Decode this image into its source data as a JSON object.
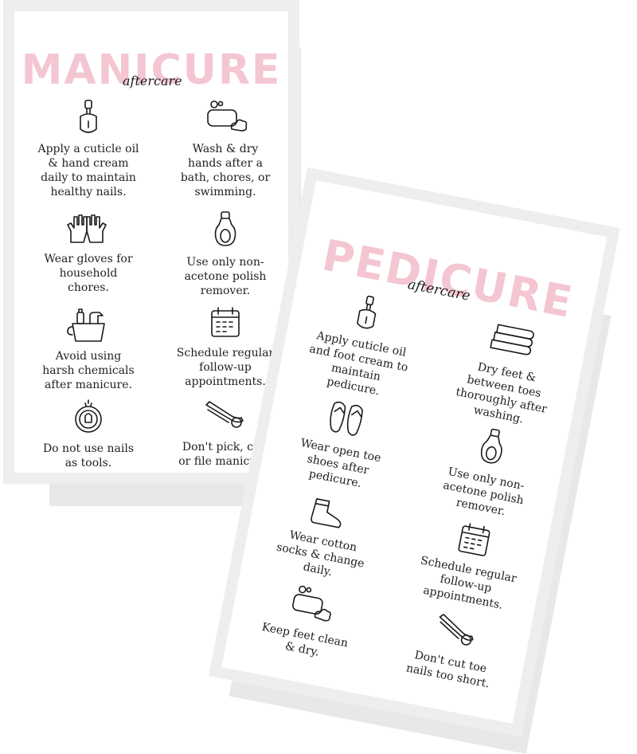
{
  "colors": {
    "title_pink": "#f4c6d1",
    "card_border": "#eeeeee",
    "shadow": "#e8e8e8",
    "ink": "#1a1a1a"
  },
  "manicure_card": {
    "title": "MANICURE",
    "subtitle": "aftercare",
    "items": [
      {
        "icon": "cuticle-oil-bottle-icon",
        "text": "Apply a cuticle oil\n& hand cream\ndaily to maintain\nhealthy nails."
      },
      {
        "icon": "soap-bar-icon",
        "text": "Wash & dry\nhands after a\nbath, chores, or\nswimming."
      },
      {
        "icon": "gloves-icon",
        "text": "Wear gloves for\nhousehold\nchores."
      },
      {
        "icon": "polish-remover-bottle-icon",
        "text": "Use only non-\nacetone polish\nremover."
      },
      {
        "icon": "cleaning-bucket-icon",
        "text": "Avoid using\nharsh chemicals\nafter manicure."
      },
      {
        "icon": "calendar-icon",
        "text": "Schedule regular\nfollow-up\nappointments."
      },
      {
        "icon": "nail-tool-icon",
        "text": "Do not use nails\nas tools."
      },
      {
        "icon": "nail-clipper-icon",
        "text": "Don't pick, cut,\nor file manicure."
      }
    ]
  },
  "pedicure_card": {
    "title": "PEDICURE",
    "subtitle": "aftercare",
    "items": [
      {
        "icon": "cuticle-oil-bottle-icon",
        "text": "Apply cuticle oil\nand foot cream to\nmaintain\npedicure."
      },
      {
        "icon": "towels-icon",
        "text": "Dry feet &\nbetween toes\nthoroughly after\nwashing."
      },
      {
        "icon": "flip-flops-icon",
        "text": "Wear open toe\nshoes after\npedicure."
      },
      {
        "icon": "polish-remover-bottle-icon",
        "text": "Use only non-\nacetone polish\nremover."
      },
      {
        "icon": "socks-icon",
        "text": "Wear cotton\nsocks & change\ndaily."
      },
      {
        "icon": "calendar-icon",
        "text": "Schedule regular\nfollow-up\nappointments."
      },
      {
        "icon": "soap-bar-icon",
        "text": "Keep feet clean\n& dry."
      },
      {
        "icon": "nail-clipper-icon",
        "text": "Don't cut toe\nnails too short."
      }
    ]
  }
}
